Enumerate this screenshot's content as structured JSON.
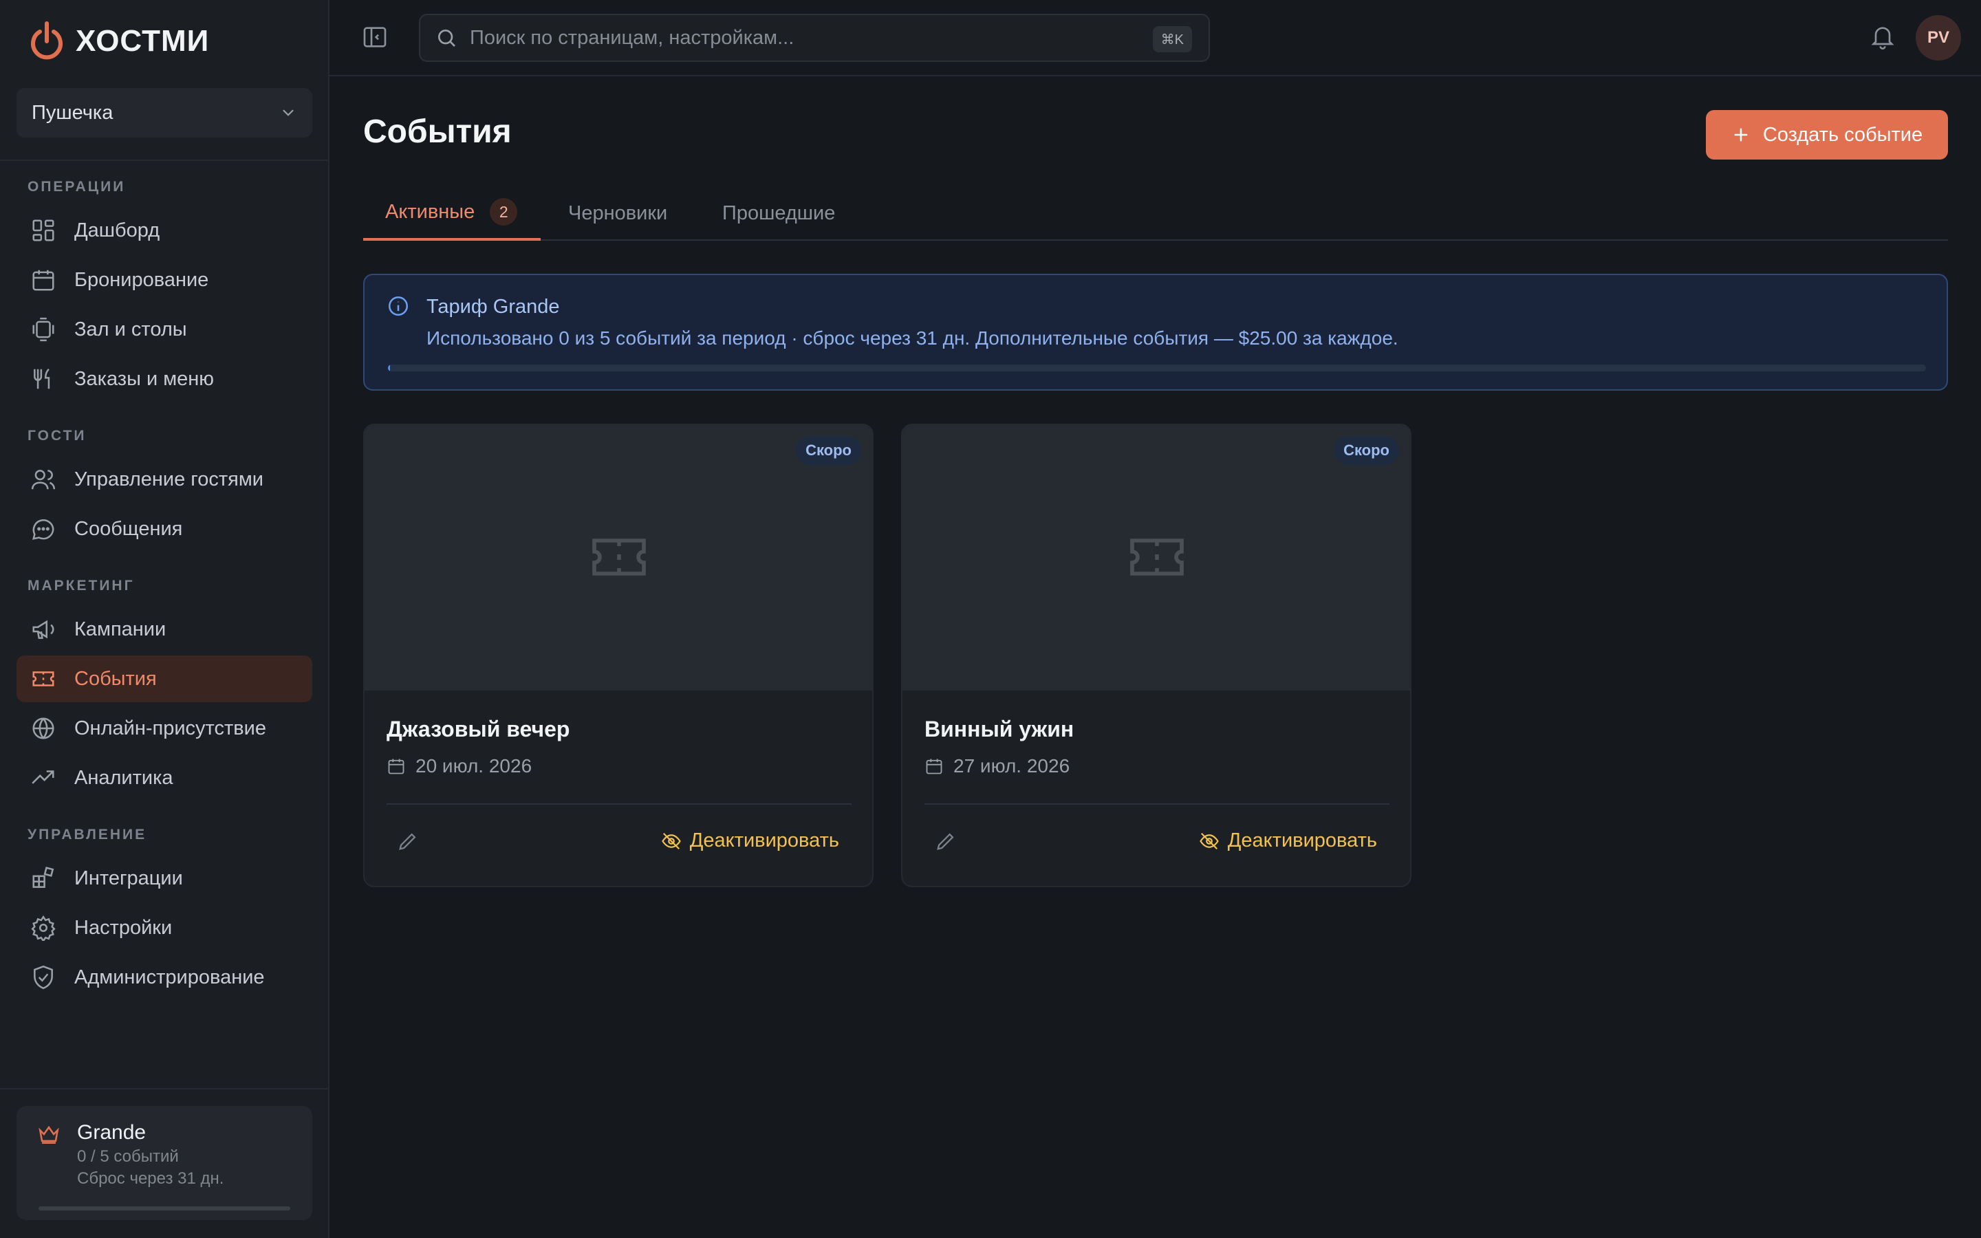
{
  "brand": {
    "name": "ХОСТМИ",
    "accent": "#e0704f"
  },
  "venue": {
    "name": "Пушечка"
  },
  "sidebar": {
    "sections": [
      {
        "label": "ОПЕРАЦИИ",
        "items": [
          {
            "label": "Дашборд",
            "icon": "dashboard-icon"
          },
          {
            "label": "Бронирование",
            "icon": "calendar-icon"
          },
          {
            "label": "Зал и столы",
            "icon": "table-icon"
          },
          {
            "label": "Заказы и меню",
            "icon": "utensils-icon"
          }
        ]
      },
      {
        "label": "ГОСТИ",
        "items": [
          {
            "label": "Управление гостями",
            "icon": "users-icon"
          },
          {
            "label": "Сообщения",
            "icon": "message-icon"
          }
        ]
      },
      {
        "label": "МАРКЕТИНГ",
        "items": [
          {
            "label": "Кампании",
            "icon": "megaphone-icon"
          },
          {
            "label": "События",
            "icon": "ticket-icon",
            "active": true
          },
          {
            "label": "Онлайн-присутствие",
            "icon": "globe-icon"
          },
          {
            "label": "Аналитика",
            "icon": "trending-icon"
          }
        ]
      },
      {
        "label": "УПРАВЛЕНИЕ",
        "items": [
          {
            "label": "Интеграции",
            "icon": "integrations-icon"
          },
          {
            "label": "Настройки",
            "icon": "gear-icon"
          },
          {
            "label": "Администрирование",
            "icon": "shield-icon"
          }
        ]
      }
    ],
    "plan": {
      "name": "Grande",
      "usage": "0 / 5 событий",
      "reset": "Сброс через 31 дн.",
      "progress": 0
    }
  },
  "topbar": {
    "search_placeholder": "Поиск по страницам, настройкам...",
    "shortcut": "⌘K",
    "avatar_initials": "PV"
  },
  "main": {
    "title": "События",
    "create_label": "Создать событие",
    "tabs": [
      {
        "label": "Активные",
        "count": "2",
        "active": true
      },
      {
        "label": "Черновики"
      },
      {
        "label": "Прошедшие"
      }
    ],
    "info": {
      "title": "Тариф Grande",
      "text": "Использовано 0 из 5 событий за период · сброс через 31 дн. Дополнительные события — $25.00 за каждое.",
      "progress": 0
    },
    "events": [
      {
        "title": "Джазовый вечер",
        "date": "20 июл. 2026",
        "badge": "Скоро",
        "action": "Деактивировать"
      },
      {
        "title": "Винный ужин",
        "date": "27 июл. 2026",
        "badge": "Скоро",
        "action": "Деактивировать"
      }
    ]
  }
}
